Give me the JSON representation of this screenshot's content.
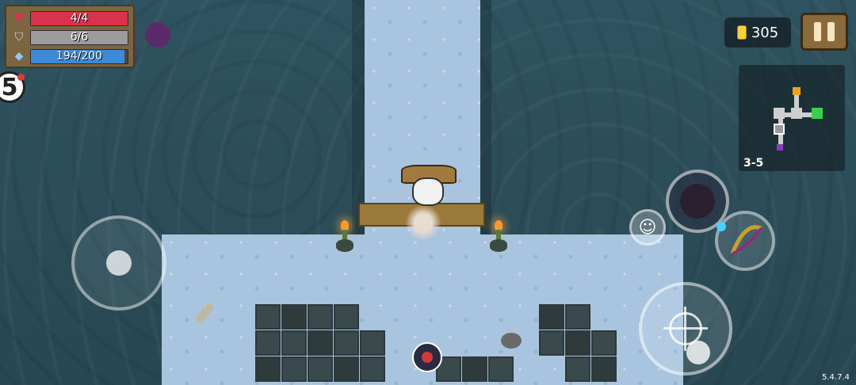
{
  "hud": {
    "health": {
      "current": 4,
      "max": 4,
      "text": "4/4",
      "color": "#d9324a"
    },
    "armor": {
      "current": 6,
      "max": 6,
      "text": "6/6",
      "color": "#9c9c9c"
    },
    "energy": {
      "current": 194,
      "max": 200,
      "text": "194/200",
      "color": "#3d8ad6"
    },
    "icons": [
      "heart-icon",
      "shield-icon",
      "energy-crystal-icon"
    ]
  },
  "currency": {
    "gems": "305",
    "icon": "gold-coin-icon"
  },
  "level_badge": {
    "value": "5",
    "notification": true
  },
  "minimap": {
    "label": "3-5"
  },
  "controls": {
    "pause_icon": "pause-icon",
    "emote_icon": "smiley-icon",
    "skill_icon": "hooded-character-icon",
    "weapon_icon": "bow-icon",
    "fire_icon": "crosshair-icon"
  },
  "version": "5.4.7.4",
  "colors": {
    "floor": "#a9c4de",
    "water": "#2f5360",
    "panel": "#7d6541"
  }
}
